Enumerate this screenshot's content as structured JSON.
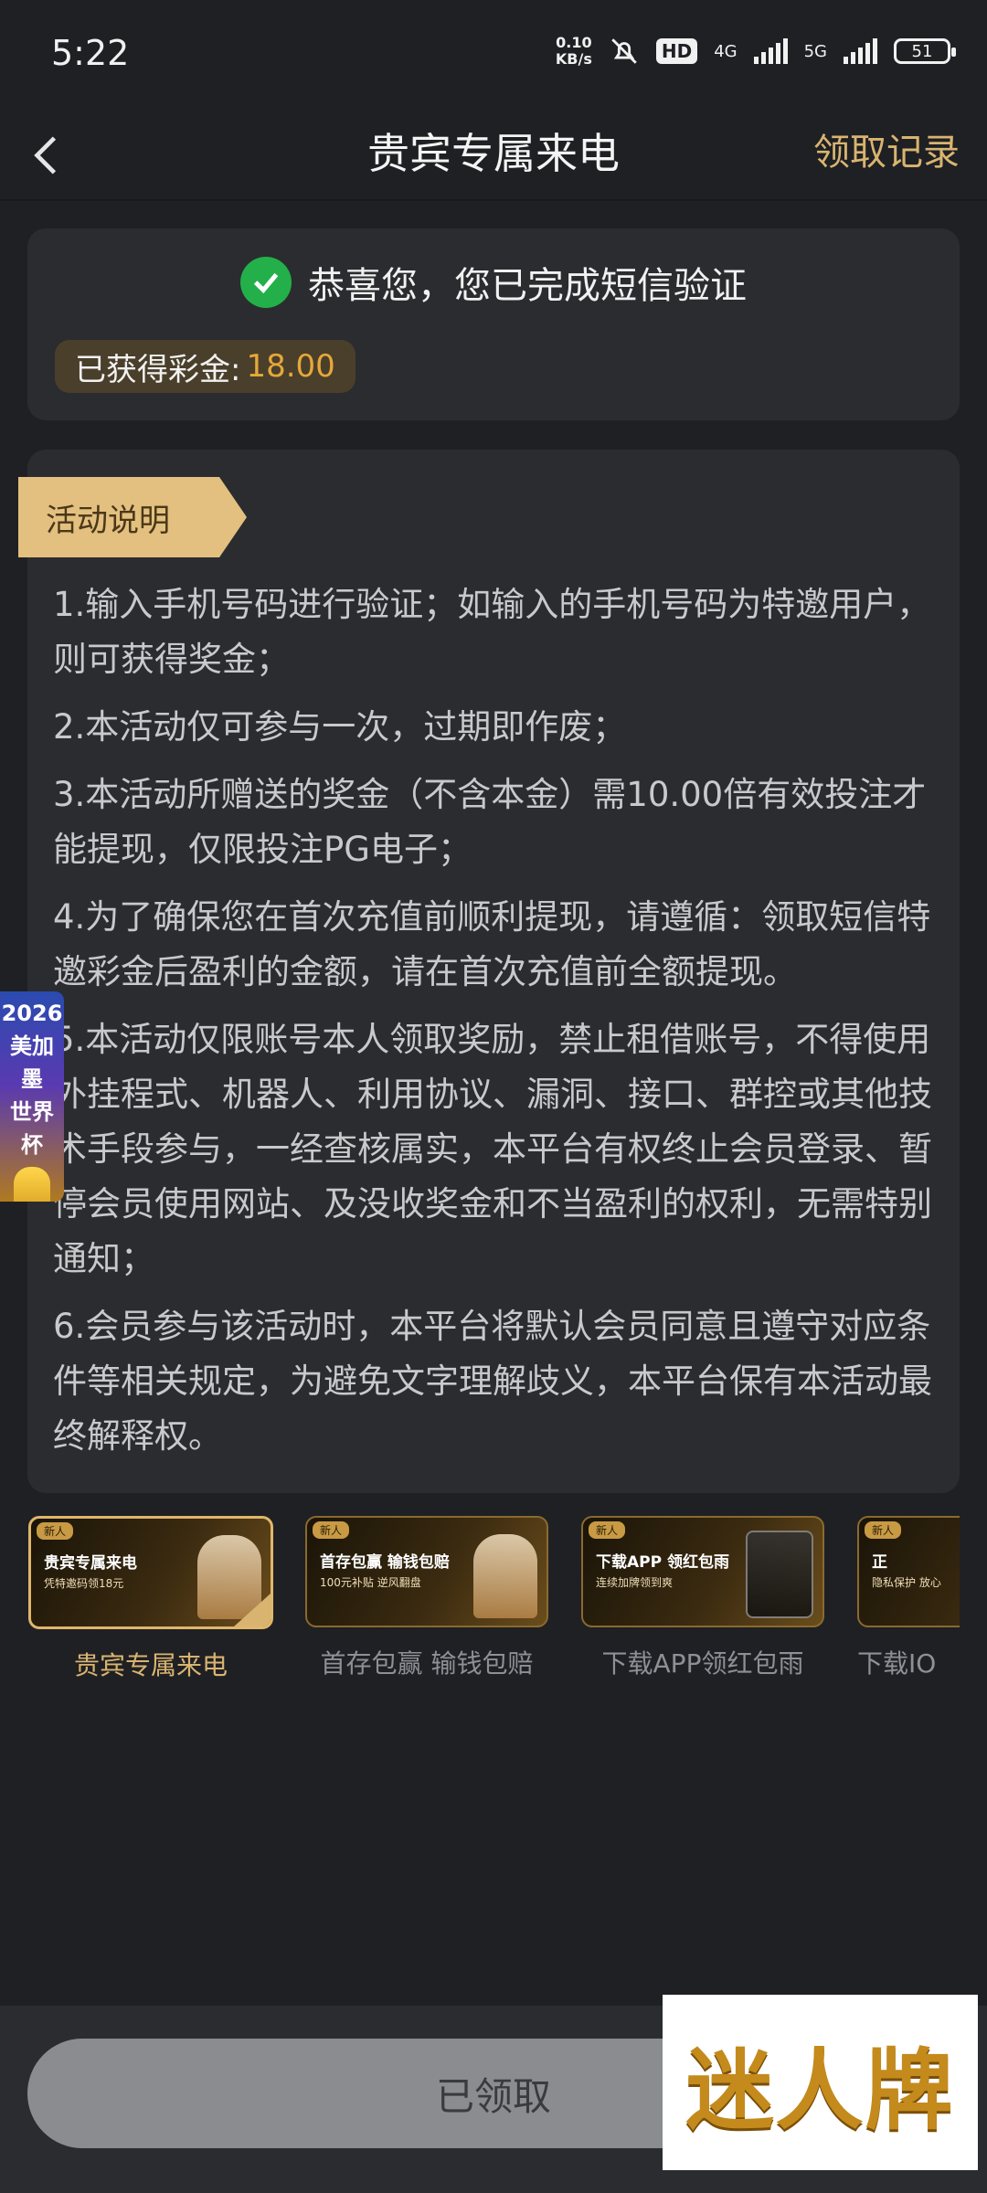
{
  "status_bar": {
    "time": "5:22",
    "net_speed_value": "0.10",
    "net_speed_unit": "KB/s",
    "hd_label": "HD",
    "network_4g": "4G",
    "network_5g": "5G",
    "battery": "51"
  },
  "header": {
    "title": "贵宾专属来电",
    "records_link": "领取记录"
  },
  "success": {
    "message": "恭喜您，您已完成短信验证",
    "bonus_label": "已获得彩金:",
    "bonus_amount": "18.00"
  },
  "activity": {
    "ribbon": "活动说明",
    "rules": [
      "1.输入手机号码进行验证；如输入的手机号码为特邀用户，则可获得奖金；",
      "2.本活动仅可参与一次，过期即作废；",
      "3.本活动所赠送的奖金（不含本金）需10.00倍有效投注才能提现，仅限投注PG电子；",
      "4.为了确保您在首次充值前顺利提现，请遵循：领取短信特邀彩金后盈利的金额，请在首次充值前全额提现。",
      "5.本活动仅限账号本人领取奖励，禁止租借账号，不得使用外挂程式、机器人、利用协议、漏洞、接口、群控或其他技术手段参与，一经查核属实，本平台有权终止会员登录、暂停会员使用网站、及没收奖金和不当盈利的权利，无需特别通知；",
      "6.会员参与该活动时，本平台将默认会员同意且遵守对应条件等相关规定，为避免文字理解歧义，本平台保有本活动最终解释权。"
    ]
  },
  "side_float": {
    "line1": "2026",
    "line2": "美加墨",
    "line3": "世界杯"
  },
  "promos": [
    {
      "badge": "新人",
      "title": "贵宾专属来电",
      "subtitle": "凭特邀码领18元",
      "label": "贵宾专属来电"
    },
    {
      "badge": "新人",
      "title": "首存包赢 输钱包赔",
      "subtitle": "100元补贴 逆风翻盘",
      "label": "首存包赢 输钱包赔"
    },
    {
      "badge": "新人",
      "title": "下载APP 领红包雨",
      "subtitle": "连续加牌领到爽",
      "label": "下载APP领红包雨"
    },
    {
      "badge": "新人",
      "title": "正",
      "subtitle": "隐私保护 放心",
      "label": "下载IO"
    }
  ],
  "bottom": {
    "claim_button": "已领取",
    "logo_text": "迷人牌"
  },
  "colors": {
    "accent_gold": "#d9b470",
    "bonus_orange": "#e5a83a",
    "success_green": "#23b04a",
    "background": "#1f2024",
    "card": "#2b2c30"
  }
}
